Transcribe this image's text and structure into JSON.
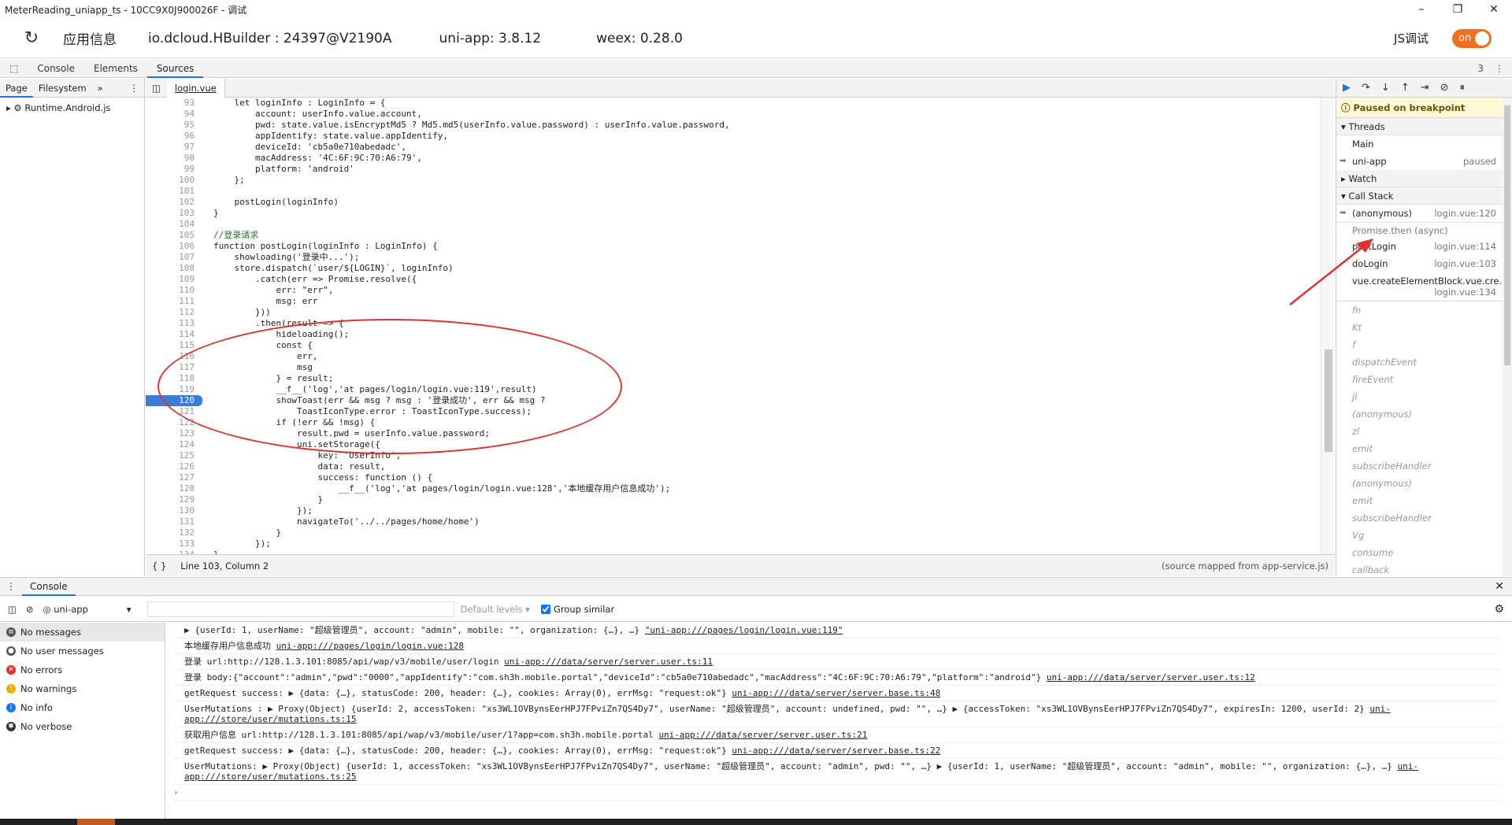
{
  "window": {
    "title": "MeterReading_uniapp_ts - 10CC9X0J900026F - 调试",
    "minimize": "–",
    "maximize": "❐",
    "close": "✕"
  },
  "infobar": {
    "app_info": "应用信息",
    "hbuilder": "io.dcloud.HBuilder : 24397@V2190A",
    "uniapp": "uni-app: 3.8.12",
    "weex": "weex: 0.28.0",
    "js_debug": "JS调试",
    "toggle": "on"
  },
  "devtools_tabs": [
    "Console",
    "Elements",
    "Sources"
  ],
  "devtools_badge": "3",
  "navigator": {
    "tabs": [
      "Page",
      "Filesystem",
      "»"
    ],
    "tree": [
      "Runtime.Android.js"
    ]
  },
  "editor": {
    "file_tab": "login.vue",
    "status_position": "Line 103, Column 2",
    "status_mapped": "(source mapped from app-service.js)",
    "breakpoint_line": 120,
    "lines": [
      {
        "n": "93",
        "t": "    let loginInfo : LoginInfo = {"
      },
      {
        "n": "94",
        "t": "        account: userInfo.value.account,"
      },
      {
        "n": "95",
        "t": "        pwd: state.value.isEncryptMd5 ? Md5.md5(userInfo.value.password) : userInfo.value.password,"
      },
      {
        "n": "96",
        "t": "        appIdentify: state.value.appIdentify,"
      },
      {
        "n": "97",
        "t": "        deviceId: 'cb5a0e710abedadc',"
      },
      {
        "n": "98",
        "t": "        macAddress: '4C:6F:9C:70:A6:79',"
      },
      {
        "n": "99",
        "t": "        platform: 'android'"
      },
      {
        "n": "100",
        "t": "    };"
      },
      {
        "n": "101",
        "t": ""
      },
      {
        "n": "102",
        "t": "    postLogin(loginInfo)"
      },
      {
        "n": "103",
        "t": "}"
      },
      {
        "n": "104",
        "t": ""
      },
      {
        "n": "105",
        "t": "//登录请求"
      },
      {
        "n": "106",
        "t": "function postLogin(loginInfo : LoginInfo) {"
      },
      {
        "n": "107",
        "t": "    showloading('登录中...');"
      },
      {
        "n": "108",
        "t": "    store.dispatch(`user/${LOGIN}`, loginInfo)"
      },
      {
        "n": "109",
        "t": "        .catch(err => Promise.resolve({"
      },
      {
        "n": "110",
        "t": "            err: \"err\","
      },
      {
        "n": "111",
        "t": "            msg: err"
      },
      {
        "n": "112",
        "t": "        }))"
      },
      {
        "n": "113",
        "t": "        .then(result => {"
      },
      {
        "n": "114",
        "t": "            hideloading();"
      },
      {
        "n": "115",
        "t": "            const {"
      },
      {
        "n": "116",
        "t": "                err,"
      },
      {
        "n": "117",
        "t": "                msg"
      },
      {
        "n": "118",
        "t": "            } = result;"
      },
      {
        "n": "119",
        "t": "            __f__('log','at pages/login/login.vue:119',result)"
      },
      {
        "n": "120",
        "t": "            showToast(err && msg ? msg : '登录成功', err && msg ?"
      },
      {
        "n": "121",
        "t": "                ToastIconType.error : ToastIconType.success);"
      },
      {
        "n": "122",
        "t": "            if (!err && !msg) {"
      },
      {
        "n": "123",
        "t": "                result.pwd = userInfo.value.password;"
      },
      {
        "n": "124",
        "t": "                uni.setStorage({"
      },
      {
        "n": "125",
        "t": "                    key: 'UserInfo',"
      },
      {
        "n": "126",
        "t": "                    data: result,"
      },
      {
        "n": "127",
        "t": "                    success: function () {"
      },
      {
        "n": "128",
        "t": "                        __f__('log','at pages/login/login.vue:128','本地缓存用户信息成功');"
      },
      {
        "n": "129",
        "t": "                    }"
      },
      {
        "n": "130",
        "t": "                });"
      },
      {
        "n": "131",
        "t": "                navigateTo('../../pages/home/home')"
      },
      {
        "n": "132",
        "t": "            }"
      },
      {
        "n": "133",
        "t": "        });"
      },
      {
        "n": "134",
        "t": "}"
      }
    ]
  },
  "debugger": {
    "buttons": [
      "▶",
      "↷",
      "↓",
      "↑",
      "⇥",
      "⊘",
      "⏸"
    ],
    "paused_text": "Paused on breakpoint",
    "threads_label": "Threads",
    "threads": [
      {
        "name": "Main",
        "state": ""
      },
      {
        "name": "uni-app",
        "state": "paused"
      }
    ],
    "watch_label": "Watch",
    "callstack_label": "Call Stack",
    "callstack": [
      {
        "name": "(anonymous)",
        "loc": "login.vue:120"
      }
    ],
    "async_label": "Promise.then (async)",
    "callstack_async": [
      {
        "name": "postLogin",
        "loc": "login.vue:114"
      },
      {
        "name": "doLogin",
        "loc": "login.vue:103"
      },
      {
        "name": "vue.createElementBlock.vue.cre...",
        "loc": "login.vue:134"
      }
    ],
    "ghost_frames": [
      "fn",
      "Kt",
      "f",
      "dispatchEvent",
      "fireEvent",
      "jl",
      "(anonymous)",
      "zl",
      "emit",
      "subscribeHandler",
      "(anonymous)",
      "emit",
      "subscribeHandler",
      "Vg",
      "consume",
      "callback"
    ]
  },
  "console": {
    "tab": "Console",
    "context": "uni-app",
    "filter_placeholder": "",
    "levels": "Default levels ▾",
    "group_similar": "Group similar",
    "sidebar": [
      {
        "label": "No messages",
        "icon": "list",
        "color": "#555"
      },
      {
        "label": "No user messages",
        "icon": "user",
        "color": "#555"
      },
      {
        "label": "No errors",
        "icon": "x",
        "color": "#e23030"
      },
      {
        "label": "No warnings",
        "icon": "!",
        "color": "#e8b000"
      },
      {
        "label": "No info",
        "icon": "i",
        "color": "#1a73e8"
      },
      {
        "label": "No verbose",
        "icon": "gear",
        "color": "#333"
      }
    ],
    "messages": [
      {
        "text": "▶ {userId: 1, userName: \"超级管理员\", account: \"admin\", mobile: \"\", organization: {…}, …} ",
        "src": "\"uni-app:///pages/login/login.vue:119\""
      },
      {
        "text": "本地缓存用户信息成功 ",
        "src": "uni-app:///pages/login/login.vue:128"
      },
      {
        "text": "登录 url:http://128.1.3.101:8085/api/wap/v3/mobile/user/login ",
        "src": "uni-app:///data/server/server.user.ts:11"
      },
      {
        "text": "登录 body:{\"account\":\"admin\",\"pwd\":\"0000\",\"appIdentify\":\"com.sh3h.mobile.portal\",\"deviceId\":\"cb5a0e710abedadc\",\"macAddress\":\"4C:6F:9C:70:A6:79\",\"platform\":\"android\"} ",
        "src": "uni-app:///data/server/server.user.ts:12"
      },
      {
        "text": "getRequest success: ▶ {data: {…}, statusCode: 200, header: {…}, cookies: Array(0), errMsg: \"request:ok\"} ",
        "src": "uni-app:///data/server/server.base.ts:48"
      },
      {
        "text": "UserMutations : ▶ Proxy(Object) {userId: 2, accessToken: \"xs3WL1OVBynsEerHPJ7FPviZn7QS4Dy7\", userName: \"超级管理员\", account: undefined, pwd: \"\", …} ▶ {accessToken: \"xs3WL1OVBynsEerHPJ7FPviZn7QS4Dy7\", expiresIn: 1200, userId: 2} ",
        "src": "uni-app:///store/user/mutations.ts:15"
      },
      {
        "text": "获取用户信息 url:http://128.1.3.101:8085/api/wap/v3/mobile/user/1?app=com.sh3h.mobile.portal ",
        "src": "uni-app:///data/server/server.user.ts:21"
      },
      {
        "text": "getRequest success: ▶ {data: {…}, statusCode: 200, header: {…}, cookies: Array(0), errMsg: \"request:ok\"} ",
        "src": "uni-app:///data/server/server.base.ts:22"
      },
      {
        "text": "UserMutations: ▶ Proxy(Object) {userId: 1, accessToken: \"xs3WL1OVBynsEerHPJ7FPviZn7QS4Dy7\", userName: \"超级管理员\", account: \"admin\", pwd: \"\", …} ▶ {userId: 1, userName: \"超级管理员\", account: \"admin\", mobile: \"\", organization: {…}, …} ",
        "src": "uni-app:///store/user/mutations.ts:25"
      }
    ],
    "prompt": "›"
  }
}
